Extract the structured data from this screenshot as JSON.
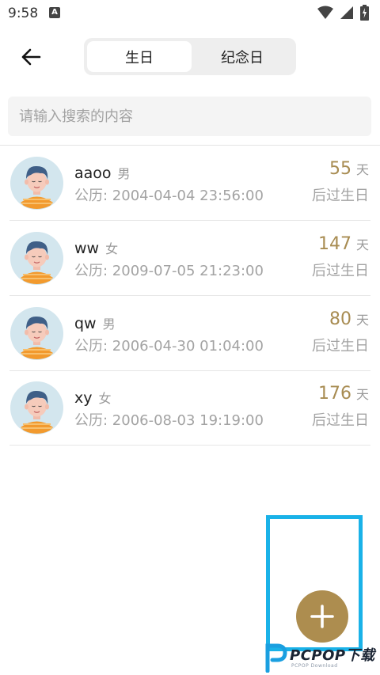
{
  "status_bar": {
    "time": "9:58",
    "notification_icon_letter": "A"
  },
  "header": {
    "tabs": [
      {
        "label": "生日",
        "active": true
      },
      {
        "label": "纪念日",
        "active": false
      }
    ]
  },
  "search": {
    "placeholder": "请输入搜索的内容",
    "value": ""
  },
  "list": {
    "items": [
      {
        "name": "aaoo",
        "gender": "男",
        "date": "公历: 2004-04-04 23:56:00",
        "days": "55",
        "days_unit": "天",
        "after_label": "后过生日"
      },
      {
        "name": "ww",
        "gender": "女",
        "date": "公历: 2009-07-05 21:23:00",
        "days": "147",
        "days_unit": "天",
        "after_label": "后过生日"
      },
      {
        "name": "qw",
        "gender": "男",
        "date": "公历: 2006-04-30 01:04:00",
        "days": "80",
        "days_unit": "天",
        "after_label": "后过生日"
      },
      {
        "name": "xy",
        "gender": "女",
        "date": "公历: 2006-08-03 19:19:00",
        "days": "176",
        "days_unit": "天",
        "after_label": "后过生日"
      }
    ]
  },
  "fab": {
    "icon": "plus-icon",
    "color": "#ad8d4f"
  },
  "highlight": {
    "color": "#1ab2e8"
  },
  "watermark": {
    "text": "PCPOP下载",
    "sub": "PCPOP Download"
  },
  "colors": {
    "accent": "#ad8d4f",
    "days_text": "#a88c52",
    "muted_text": "#a3a3a3"
  }
}
